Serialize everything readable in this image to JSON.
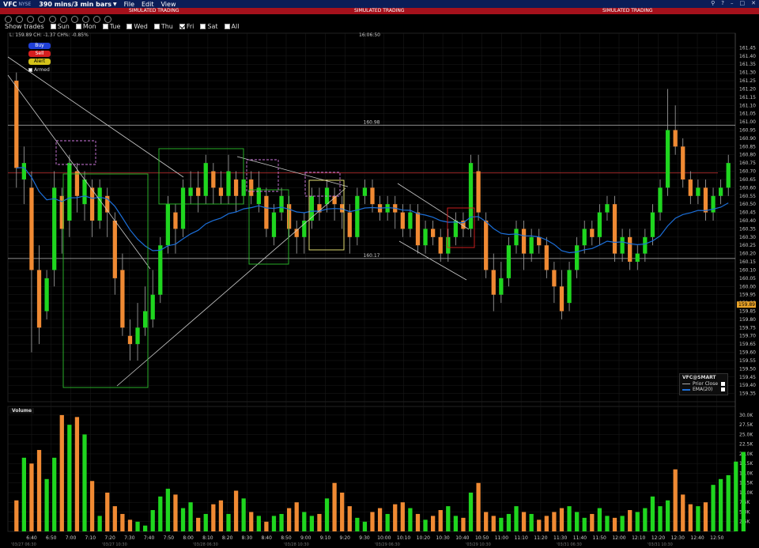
{
  "header": {
    "symbol": "VFC",
    "exchange": "NYSE",
    "timeframe": "390 mins/3 min bars",
    "menus": [
      "File",
      "Edit",
      "View"
    ]
  },
  "sim_label": "SIMULATED TRADING",
  "show_trades": {
    "label": "Show trades",
    "days": [
      {
        "name": "Sun",
        "checked": false
      },
      {
        "name": "Mon",
        "checked": false
      },
      {
        "name": "Tue",
        "checked": false
      },
      {
        "name": "Wed",
        "checked": false
      },
      {
        "name": "Thu",
        "checked": false
      },
      {
        "name": "Fri",
        "checked": true
      },
      {
        "name": "Sat",
        "checked": false
      },
      {
        "name": "All",
        "checked": false
      }
    ]
  },
  "quote_line": "L: 159.89  CH: -1.37  CH%: -0.85%",
  "cursor_time": "16:06:50",
  "order_panel": {
    "buy": "Buy",
    "sell": "Sell",
    "alert": "Alert",
    "armed": "Armed"
  },
  "legend": {
    "title": "VFC@SMART",
    "prior_close": "Prior Close",
    "ema": "EMA(20)"
  },
  "volume_label": "Volume",
  "colors": {
    "up": "#1fd61f",
    "down": "#f08a33",
    "ema": "#1c6fd9",
    "prior_close": "#9e2a2a",
    "last_price_tag": "#e9a227",
    "grid": "#1c1c1c"
  },
  "chart_data": {
    "type": "candlestick",
    "ylim": [
      159.3,
      161.5
    ],
    "y_ticks": [
      161.45,
      161.4,
      161.35,
      161.3,
      161.25,
      161.2,
      161.15,
      161.1,
      161.05,
      161.0,
      160.95,
      160.9,
      160.85,
      160.8,
      160.75,
      160.7,
      160.65,
      160.6,
      160.55,
      160.5,
      160.45,
      160.4,
      160.35,
      160.3,
      160.25,
      160.2,
      160.15,
      160.1,
      160.05,
      160.0,
      159.95,
      159.9,
      159.85,
      159.8,
      159.75,
      159.7,
      159.65,
      159.6,
      159.55,
      159.5,
      159.45,
      159.4,
      159.35
    ],
    "x_ticks": [
      "6:40",
      "6:50",
      "7:00",
      "7:10",
      "7:20",
      "7:30",
      "7:40",
      "7:50",
      "8:00",
      "8:10",
      "8:20",
      "8:30",
      "8:40",
      "8:50",
      "9:00",
      "9:10",
      "9:20",
      "9:30",
      "10:00",
      "10:10",
      "10:20",
      "10:30",
      "10:40",
      "10:50",
      "11:00",
      "11:10",
      "11:20",
      "11:30",
      "11:40",
      "11:50",
      "12:00",
      "12:10",
      "12:20",
      "12:30",
      "12:40",
      "12:50"
    ],
    "date_labels": [
      "'03/27 06:30",
      "'03/27 10:30",
      "'03/28 06:30",
      "'03/28 10:30",
      "'03/29 06:30",
      "'03/29 10:30",
      "'03/31 06:30",
      "'03/31 10:30"
    ],
    "hlines": [
      {
        "label": "160.98",
        "value": 160.98
      },
      {
        "label": "160.17",
        "value": 160.17
      }
    ],
    "prior_close": 160.69,
    "last_price": {
      "label": "159.89",
      "value": 159.89
    },
    "volume_ticks": [
      "30.0K",
      "27.5K",
      "25.0K",
      "22.5K",
      "20.0K",
      "17.5K",
      "15.0K",
      "12.5K",
      "10.0K",
      "7.5K",
      "5.0K",
      "2.5K"
    ],
    "volume_ylim": [
      0,
      31000
    ],
    "candles": [
      [
        161.25,
        160.72,
        161.3,
        160.6
      ],
      [
        160.65,
        160.75,
        160.85,
        160.5
      ],
      [
        160.6,
        160.1,
        160.7,
        159.6
      ],
      [
        160.1,
        159.75,
        160.25,
        159.65
      ],
      [
        159.85,
        160.05,
        160.1,
        159.8
      ],
      [
        160.1,
        160.6,
        160.7,
        160.0
      ],
      [
        160.55,
        160.35,
        160.6,
        160.2
      ],
      [
        160.4,
        160.75,
        160.8,
        160.3
      ],
      [
        160.7,
        160.55,
        160.75,
        160.45
      ],
      [
        160.5,
        160.65,
        160.7,
        160.4
      ],
      [
        160.6,
        160.4,
        160.65,
        160.3
      ],
      [
        160.4,
        160.6,
        160.65,
        160.35
      ],
      [
        160.55,
        160.45,
        160.6,
        160.3
      ],
      [
        160.4,
        160.05,
        160.45,
        159.95
      ],
      [
        160.1,
        159.75,
        160.2,
        159.7
      ],
      [
        159.7,
        159.65,
        159.8,
        159.55
      ],
      [
        159.65,
        159.75,
        159.9,
        159.55
      ],
      [
        159.75,
        159.85,
        160.0,
        159.7
      ],
      [
        159.8,
        159.95,
        160.1,
        159.75
      ],
      [
        159.95,
        160.25,
        160.3,
        159.9
      ],
      [
        160.25,
        160.5,
        160.55,
        160.2
      ],
      [
        160.45,
        160.35,
        160.5,
        160.2
      ],
      [
        160.35,
        160.6,
        160.65,
        160.3
      ],
      [
        160.55,
        160.6,
        160.7,
        160.5
      ],
      [
        160.6,
        160.55,
        160.7,
        160.45
      ],
      [
        160.55,
        160.75,
        160.8,
        160.5
      ],
      [
        160.7,
        160.6,
        160.75,
        160.5
      ],
      [
        160.6,
        160.55,
        160.7,
        160.5
      ],
      [
        160.55,
        160.7,
        160.8,
        160.5
      ],
      [
        160.65,
        160.55,
        160.7,
        160.45
      ],
      [
        160.55,
        160.65,
        160.7,
        160.5
      ],
      [
        160.65,
        160.55,
        160.7,
        160.5
      ],
      [
        160.5,
        160.6,
        160.7,
        160.45
      ],
      [
        160.55,
        160.35,
        160.6,
        160.3
      ],
      [
        160.3,
        160.45,
        160.5,
        160.25
      ],
      [
        160.45,
        160.55,
        160.6,
        160.4
      ],
      [
        160.5,
        160.35,
        160.55,
        160.3
      ],
      [
        160.35,
        160.3,
        160.4,
        160.2
      ],
      [
        160.3,
        160.4,
        160.45,
        160.2
      ],
      [
        160.4,
        160.55,
        160.6,
        160.35
      ],
      [
        160.5,
        160.45,
        160.6,
        160.4
      ],
      [
        160.5,
        160.6,
        160.65,
        160.45
      ],
      [
        160.55,
        160.5,
        160.6,
        160.4
      ],
      [
        160.5,
        160.45,
        160.55,
        160.35
      ],
      [
        160.45,
        160.3,
        160.5,
        160.2
      ],
      [
        160.3,
        160.55,
        160.6,
        160.25
      ],
      [
        160.55,
        160.6,
        160.65,
        160.5
      ],
      [
        160.6,
        160.5,
        160.65,
        160.45
      ],
      [
        160.5,
        160.45,
        160.55,
        160.4
      ],
      [
        160.45,
        160.5,
        160.55,
        160.4
      ],
      [
        160.5,
        160.45,
        160.55,
        160.35
      ],
      [
        160.45,
        160.35,
        160.5,
        160.3
      ],
      [
        160.35,
        160.45,
        160.5,
        160.3
      ],
      [
        160.45,
        160.25,
        160.5,
        160.2
      ],
      [
        160.25,
        160.35,
        160.4,
        160.2
      ],
      [
        160.35,
        160.3,
        160.4,
        160.25
      ],
      [
        160.3,
        160.2,
        160.35,
        160.15
      ],
      [
        160.2,
        160.3,
        160.35,
        160.15
      ],
      [
        160.3,
        160.4,
        160.45,
        160.25
      ],
      [
        160.4,
        160.35,
        160.45,
        160.3
      ],
      [
        160.35,
        160.75,
        160.8,
        160.3
      ],
      [
        160.7,
        160.45,
        160.8,
        160.4
      ],
      [
        160.4,
        160.1,
        160.45,
        160.05
      ],
      [
        160.1,
        159.95,
        160.2,
        159.85
      ],
      [
        159.95,
        160.05,
        160.15,
        159.9
      ],
      [
        160.05,
        160.25,
        160.3,
        160.0
      ],
      [
        160.25,
        160.35,
        160.4,
        160.2
      ],
      [
        160.35,
        160.2,
        160.4,
        160.1
      ],
      [
        160.2,
        160.3,
        160.35,
        160.15
      ],
      [
        160.3,
        160.25,
        160.35,
        160.2
      ],
      [
        160.25,
        160.1,
        160.3,
        160.05
      ],
      [
        160.1,
        160.0,
        160.15,
        159.9
      ],
      [
        160.0,
        159.85,
        160.1,
        159.8
      ],
      [
        159.9,
        160.1,
        160.15,
        159.85
      ],
      [
        160.1,
        160.25,
        160.3,
        160.05
      ],
      [
        160.25,
        160.35,
        160.4,
        160.2
      ],
      [
        160.35,
        160.3,
        160.4,
        160.25
      ],
      [
        160.3,
        160.45,
        160.5,
        160.25
      ],
      [
        160.45,
        160.5,
        160.55,
        160.4
      ],
      [
        160.5,
        160.2,
        160.55,
        160.15
      ],
      [
        160.2,
        160.3,
        160.35,
        160.15
      ],
      [
        160.3,
        160.15,
        160.35,
        160.1
      ],
      [
        160.15,
        160.2,
        160.25,
        160.1
      ],
      [
        160.2,
        160.3,
        160.35,
        160.15
      ],
      [
        160.3,
        160.45,
        160.5,
        160.25
      ],
      [
        160.45,
        160.6,
        160.65,
        160.4
      ],
      [
        160.6,
        160.95,
        161.2,
        160.55
      ],
      [
        160.95,
        160.85,
        161.1,
        160.8
      ],
      [
        160.85,
        160.65,
        160.9,
        160.6
      ],
      [
        160.65,
        160.55,
        160.7,
        160.5
      ],
      [
        160.55,
        160.6,
        160.65,
        160.5
      ],
      [
        160.6,
        160.45,
        160.65,
        160.4
      ],
      [
        160.45,
        160.55,
        160.6,
        160.4
      ],
      [
        160.55,
        160.6,
        160.65,
        160.5
      ],
      [
        160.6,
        160.75,
        160.8,
        160.55
      ]
    ],
    "volumes": [
      8000,
      19000,
      17500,
      21000,
      13500,
      19000,
      30000,
      27500,
      29500,
      25000,
      13000,
      4000,
      10000,
      6500,
      4500,
      3000,
      2500,
      1500,
      5500,
      9000,
      11000,
      9500,
      6000,
      7500,
      3500,
      4500,
      7000,
      8000,
      4500,
      10500,
      8500,
      5000,
      4000,
      2500,
      4000,
      4500,
      6000,
      7500,
      5000,
      4000,
      4500,
      8500,
      12500,
      10000,
      6500,
      3500,
      2500,
      5000,
      6000,
      4500,
      7000,
      7500,
      6000,
      4500,
      3000,
      4000,
      5500,
      6500,
      4000,
      3500,
      10000,
      12500,
      5000,
      4000,
      3500,
      4500,
      6500,
      5000,
      4500,
      3000,
      4000,
      5000,
      6000,
      6500,
      5000,
      3500,
      4500,
      6000,
      4000,
      3500,
      4000,
      5500,
      5000,
      6000,
      9000,
      6500,
      8000,
      16000,
      9500,
      7000,
      6500,
      7500,
      12000,
      13500,
      14500,
      18000,
      20500
    ]
  }
}
